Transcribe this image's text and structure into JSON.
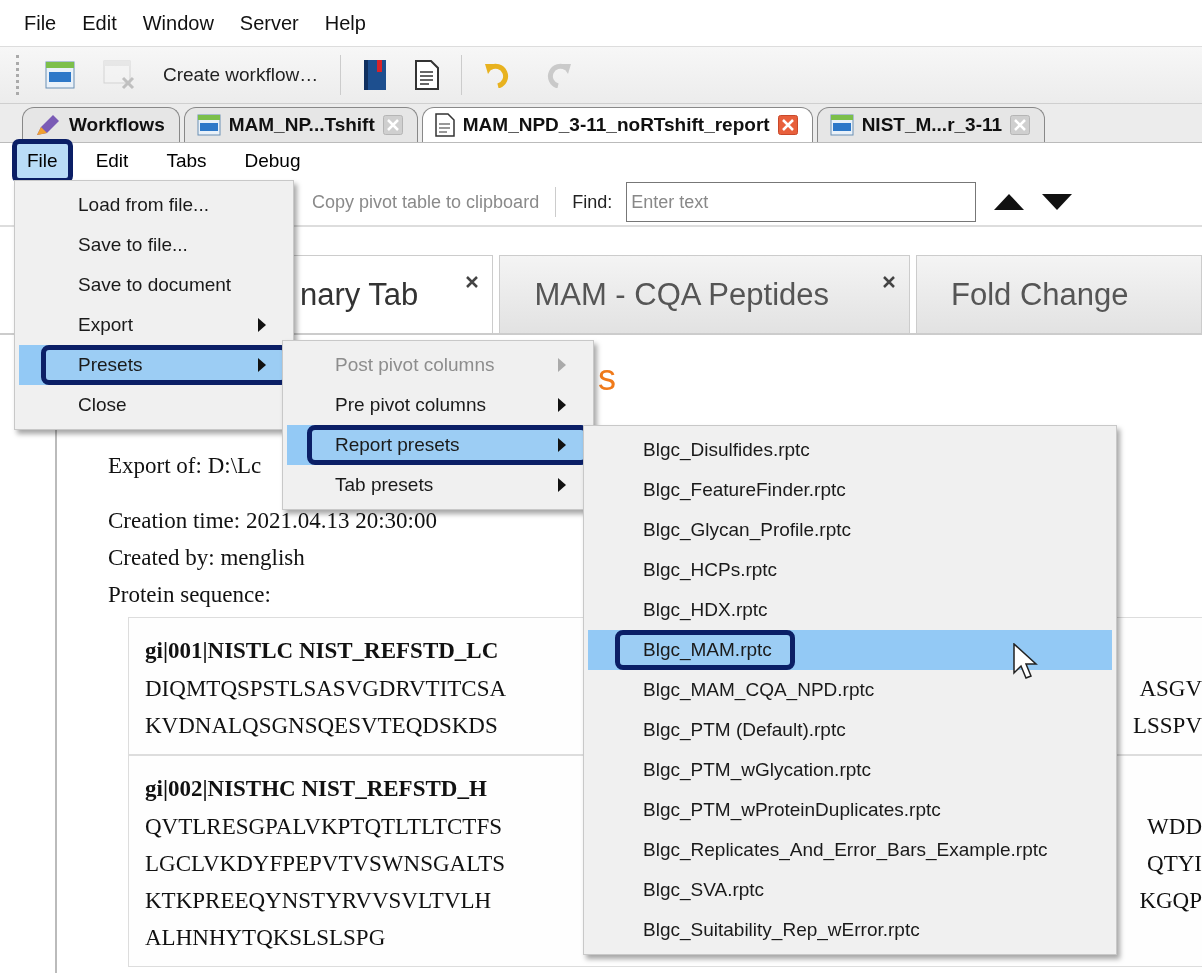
{
  "menu_bar": [
    {
      "label": "File"
    },
    {
      "label": "Edit"
    },
    {
      "label": "Window"
    },
    {
      "label": "Server"
    },
    {
      "label": "Help"
    }
  ],
  "toolbar": [
    {
      "kind": "new",
      "disabled": false
    },
    {
      "kind": "close",
      "disabled": true
    },
    {
      "kind": "create",
      "label": "Create workflow…",
      "disabled": false
    },
    {
      "kind": "separator"
    },
    {
      "kind": "book",
      "disabled": false
    },
    {
      "kind": "report",
      "disabled": false
    },
    {
      "kind": "separator"
    },
    {
      "kind": "undo",
      "disabled": false
    },
    {
      "kind": "redo",
      "disabled": true
    }
  ],
  "document_tabs": [
    {
      "label": "Workflows",
      "kind": "workflows",
      "selected": false,
      "closable": false
    },
    {
      "label": "MAM_NP...Tshift",
      "kind": "workflow",
      "selected": false,
      "closable": true
    },
    {
      "label": "MAM_NPD_3-11_noRTshift_report",
      "kind": "report",
      "selected": true,
      "closable": true
    },
    {
      "label": "NIST_M...r_3-11",
      "kind": "workflow",
      "selected": false,
      "closable": true
    }
  ],
  "report_menu_bar": [
    {
      "label": "File",
      "selected": true
    },
    {
      "label": "Edit",
      "selected": false
    },
    {
      "label": "Tabs",
      "selected": false
    },
    {
      "label": "Debug",
      "selected": false
    }
  ],
  "report_toolbar": {
    "copy_label": "Copy pivot table to clipboard",
    "copy_disabled": true,
    "find_label": "Find:",
    "find_placeholder": "Enter text"
  },
  "report_tabs": [
    {
      "label": "nary Tab",
      "selected": true,
      "closable": true
    },
    {
      "label": "MAM - CQA Peptides",
      "selected": false,
      "closable": true
    },
    {
      "label": "Fold Change",
      "selected": false,
      "closable": false
    }
  ],
  "report": {
    "title": "s",
    "info": [
      "Export of: D:\\Lc",
      "Creation time: 2021.04.13 20:30:00",
      "Created by: menglish",
      "Protein sequence:"
    ],
    "sequences": [
      {
        "header": "gi|001|NISTLC NIST_REFSTD_LC",
        "lines": [
          {
            "left": "DIQMTQSPSTLSASVGDRVTITCSA",
            "right": "ASGV"
          },
          {
            "left": "KVDNALQSGNSQESVTEQDSKDS",
            "right": "LSSPV"
          }
        ]
      },
      {
        "header": "gi|002|NISTHC NIST_REFSTD_H",
        "lines": [
          {
            "left": "QVTLRESGPALVKPTQTLTLTCTFS",
            "right": "WDD"
          },
          {
            "left": "LGCLVKDYFPEPVTVSWNSGALTS",
            "right": "QTYI"
          },
          {
            "left": "KTKPREEQYNSTYRVVSVLTVLH",
            "right": "KGQP"
          },
          {
            "left": "ALHNHYTQKSLSLSPG"
          }
        ]
      }
    ]
  },
  "file_menu": [
    {
      "label": "Load from file...",
      "submenu": false,
      "selected": false
    },
    {
      "label": "Save to file...",
      "submenu": false,
      "selected": false
    },
    {
      "label": "Save to document",
      "submenu": false,
      "selected": false
    },
    {
      "label": "Export",
      "submenu": true,
      "selected": false
    },
    {
      "label": "Presets",
      "submenu": true,
      "selected": true
    },
    {
      "label": "Close",
      "submenu": false,
      "selected": false
    }
  ],
  "presets_menu": [
    {
      "label": "Post pivot columns",
      "disabled": true,
      "selected": false
    },
    {
      "label": "Pre pivot columns",
      "disabled": false,
      "selected": false
    },
    {
      "label": "Report presets",
      "disabled": false,
      "selected": true
    },
    {
      "label": "Tab presets",
      "disabled": false,
      "selected": false
    }
  ],
  "report_presets_menu": [
    {
      "label": "Blgc_Disulfides.rptc",
      "selected": false
    },
    {
      "label": "Blgc_FeatureFinder.rptc",
      "selected": false
    },
    {
      "label": "Blgc_Glycan_Profile.rptc",
      "selected": false
    },
    {
      "label": "Blgc_HCPs.rptc",
      "selected": false
    },
    {
      "label": "Blgc_HDX.rptc",
      "selected": false
    },
    {
      "label": "Blgc_MAM.rptc",
      "selected": true
    },
    {
      "label": "Blgc_MAM_CQA_NPD.rptc",
      "selected": false
    },
    {
      "label": "Blgc_PTM (Default).rptc",
      "selected": false
    },
    {
      "label": "Blgc_PTM_wGlycation.rptc",
      "selected": false
    },
    {
      "label": "Blgc_PTM_wProteinDuplicates.rptc",
      "selected": false
    },
    {
      "label": "Blgc_Replicates_And_Error_Bars_Example.rptc",
      "selected": false
    },
    {
      "label": "Blgc_SVA.rptc",
      "selected": false
    },
    {
      "label": "Blgc_Suitability_Rep_wError.rptc",
      "selected": false
    }
  ]
}
